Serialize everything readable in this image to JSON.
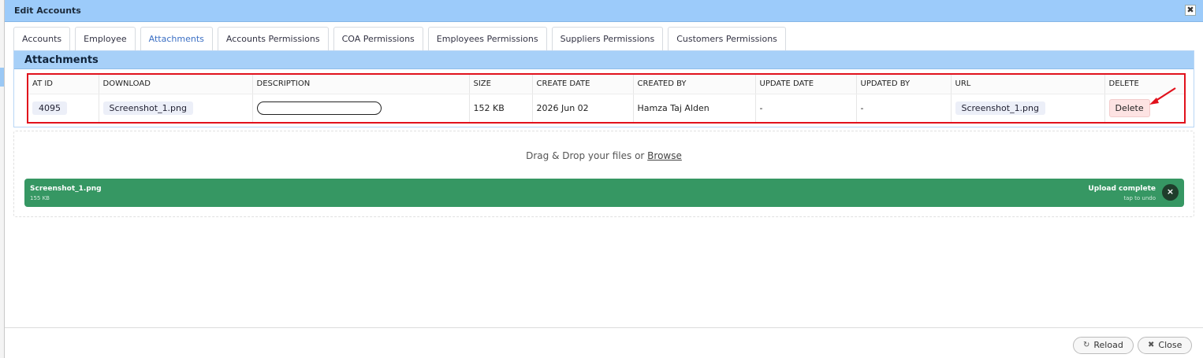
{
  "window": {
    "title": "Edit Accounts",
    "close_glyph": "✖"
  },
  "tabs": [
    {
      "label": "Accounts",
      "active": false
    },
    {
      "label": "Employee",
      "active": false
    },
    {
      "label": "Attachments",
      "active": true
    },
    {
      "label": "Accounts Permissions",
      "active": false
    },
    {
      "label": "COA Permissions",
      "active": false
    },
    {
      "label": "Employees Permissions",
      "active": false
    },
    {
      "label": "Suppliers Permissions",
      "active": false
    },
    {
      "label": "Customers Permissions",
      "active": false
    }
  ],
  "attachments": {
    "title": "Attachments",
    "columns": [
      "AT ID",
      "DOWNLOAD",
      "DESCRIPTION",
      "SIZE",
      "CREATE DATE",
      "CREATED BY",
      "UPDATE DATE",
      "UPDATED BY",
      "URL",
      "DELETE"
    ],
    "rows": [
      {
        "at_id": "4095",
        "download": "Screenshot_1.png",
        "description": "",
        "size": "152 KB",
        "create_date": "2026 Jun 02",
        "created_by": "Hamza Taj Alden",
        "update_date": "-",
        "updated_by": "-",
        "url": "Screenshot_1.png",
        "delete_label": "Delete"
      }
    ]
  },
  "upload": {
    "drop_text": "Drag & Drop your files or",
    "browse_label": "Browse",
    "file_name": "Screenshot_1.png",
    "file_size": "155 KB",
    "status": "Upload complete",
    "undo_hint": "tap to undo",
    "remove_glyph": "×"
  },
  "footer": {
    "reload_label": "Reload",
    "reload_icon": "↻",
    "close_label": "Close",
    "close_icon": "✖"
  },
  "colors": {
    "titlebar": "#9ccbfa",
    "highlight_border": "#e1111c",
    "upload_bar": "#369763",
    "delete_bg": "#fde3e3"
  }
}
